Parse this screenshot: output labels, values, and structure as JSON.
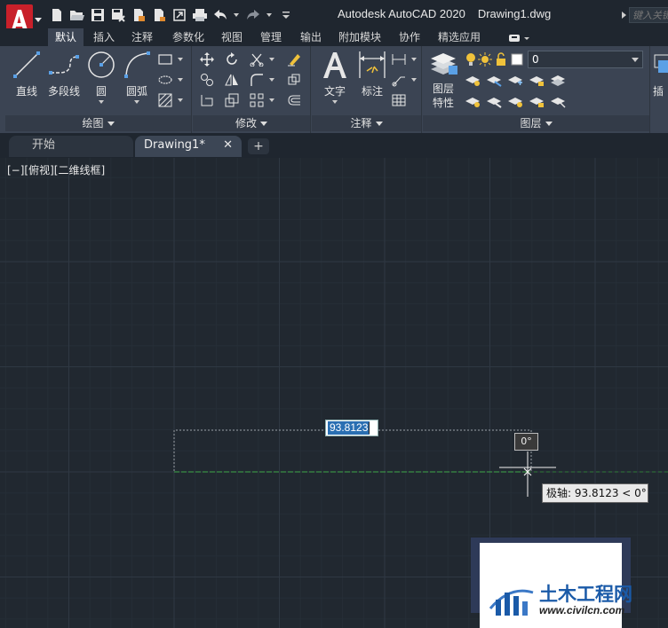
{
  "app": {
    "title": "Autodesk AutoCAD 2020",
    "document": "Drawing1.dwg",
    "search_placeholder": "键入关键字或短语"
  },
  "qat": {
    "icons": [
      "new-icon",
      "open-icon",
      "save-icon",
      "save-as-icon",
      "open-from-web-icon",
      "save-to-web-icon",
      "plot-icon",
      "undo-icon",
      "redo-icon",
      "customize-qat-icon"
    ]
  },
  "menu_tabs": [
    "默认",
    "插入",
    "注释",
    "参数化",
    "视图",
    "管理",
    "输出",
    "附加模块",
    "协作",
    "精选应用"
  ],
  "ribbon": {
    "draw": {
      "label": "绘图",
      "line": "直线",
      "polyline": "多段线",
      "circle": "圆",
      "arc": "圆弧"
    },
    "modify": {
      "label": "修改"
    },
    "annotation": {
      "label": "注释",
      "text": "文字",
      "dimension": "标注"
    },
    "layers": {
      "label": "图层",
      "layer_properties_line1": "图层",
      "layer_properties_line2": "特性",
      "current_layer": "0"
    },
    "insert_partial": "插"
  },
  "doc_tabs": {
    "start": "开始",
    "drawing": "Drawing1*",
    "close": "✕",
    "new": "+"
  },
  "viewport": {
    "label": "[−][俯视][二维线框]"
  },
  "dynamic_input": {
    "length_value": "93.8123",
    "angle_value": "0°",
    "polar_tooltip": "极轴: 93.8123 < 0°"
  },
  "watermark": {
    "site_name": "土木工程网",
    "url": "www.civilcn.com"
  },
  "colors": {
    "titlebar": "#1f262f",
    "ribbon": "#3b4453",
    "canvas": "#212830",
    "grid_minor": "#262e37",
    "grid_major": "#2f3843",
    "selection": "#2a6fb2",
    "rubber_band": "#3fa84a",
    "brand_red": "#c8202a"
  }
}
